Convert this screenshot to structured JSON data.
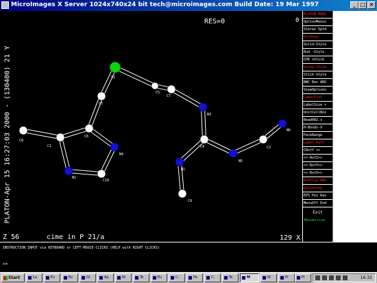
{
  "window": {
    "title": "MicroImages X Server  1024x740x24 bit  tech@microimages.com  Build Date: 19 Mar 1997"
  },
  "canvas": {
    "res_label": "RES=0",
    "corner_zero": "0",
    "side_stamp": "PLATON-Apr 15 16:27:03 2000 - (130400)  21 Y",
    "z_label": "Z 56",
    "cell_label": "cime in P 21/a",
    "scale_label": "129 X",
    "atom_colors": {
      "carbon": "#ffffff",
      "nitrogen": "#1010e0",
      "sulfur": "#10d010",
      "bond": "#ffffff"
    },
    "atoms": [
      {
        "id": "S1",
        "label": "S1",
        "type": "sulfur"
      },
      {
        "id": "C5a",
        "label": "C5",
        "type": "carbon"
      },
      {
        "id": "C5b",
        "label": "C5",
        "type": "carbon"
      },
      {
        "id": "C7",
        "label": "C7",
        "type": "carbon"
      },
      {
        "id": "N3",
        "label": "N3",
        "type": "nitrogen"
      },
      {
        "id": "C4",
        "label": "C4",
        "type": "carbon"
      },
      {
        "id": "N5",
        "label": "N5",
        "type": "nitrogen"
      },
      {
        "id": "C2",
        "label": "C2",
        "type": "carbon"
      },
      {
        "id": "N6",
        "label": "N6",
        "type": "nitrogen"
      },
      {
        "id": "N1",
        "label": "N1",
        "type": "nitrogen"
      },
      {
        "id": "C9",
        "label": "C9",
        "type": "carbon"
      },
      {
        "id": "C6",
        "label": "C6",
        "type": "carbon"
      },
      {
        "id": "C1",
        "label": "C1",
        "type": "carbon"
      },
      {
        "id": "C8",
        "label": "C8",
        "type": "carbon"
      },
      {
        "id": "N2",
        "label": "N2",
        "type": "nitrogen"
      },
      {
        "id": "C10",
        "label": "C10",
        "type": "carbon"
      },
      {
        "id": "N4",
        "label": "N4",
        "type": "nitrogen"
      }
    ],
    "bonds": [
      [
        "S1",
        "C5b"
      ],
      [
        "C5b",
        "C7"
      ],
      [
        "C7",
        "N3"
      ],
      [
        "N3",
        "C4"
      ],
      [
        "C4",
        "N1"
      ],
      [
        "N1",
        "C9"
      ],
      [
        "C4",
        "N5"
      ],
      [
        "N5",
        "C2"
      ],
      [
        "C2",
        "N6"
      ],
      [
        "S1",
        "C5a"
      ],
      [
        "C5a",
        "C6"
      ],
      [
        "C6",
        "C1"
      ],
      [
        "C1",
        "C8"
      ],
      [
        "C1",
        "N2"
      ],
      [
        "N2",
        "C10"
      ],
      [
        "C10",
        "N4"
      ],
      [
        "N4",
        "C6"
      ]
    ]
  },
  "menu": {
    "header": "PLATON MENU",
    "items": [
      {
        "label": "OptionMenus",
        "active": false
      },
      {
        "label": "Stereo Optd",
        "active": false
      },
      {
        "label": "OrtShow",
        "active": true
      },
      {
        "label": "Solid-Style",
        "active": false
      },
      {
        "label": "Rod  -Style",
        "active": false
      },
      {
        "label": "CPK  +Stick",
        "active": false
      },
      {
        "label": "Ortep-Style",
        "active": true
      },
      {
        "label": "Stick-Style",
        "active": false
      },
      {
        "label": "BWC Res ARU",
        "active": false
      },
      {
        "label": "ViewOptions",
        "active": false
      },
      {
        "label": "LabelPlot",
        "active": true
      },
      {
        "label": "LabelSize >",
        "active": false
      },
      {
        "label": "UnitCellBox",
        "active": false
      },
      {
        "label": "Read002.x",
        "active": false
      },
      {
        "label": "H-Bonds-X",
        "active": false
      },
      {
        "label": "PackRange",
        "active": false
      },
      {
        "label": "Label  Raff",
        "active": true
      },
      {
        "label": "CRotY >>",
        "active": false
      },
      {
        "label": "<<-RotZ>>",
        "active": false
      },
      {
        "label": "<<-RotY>>",
        "active": false
      },
      {
        "label": "<<-RotX>>",
        "active": false
      },
      {
        "label": "RotFlip ARU",
        "active": true
      },
      {
        "label": "Quickstep",
        "active": true
      },
      {
        "label": "EPS Pov Ras",
        "active": false
      },
      {
        "label": "MenuOff End",
        "active": false
      }
    ],
    "exit": "Exit",
    "footer": "MenuActive"
  },
  "instruction": {
    "text": "INSTRUCTION INPUT via KEYBOARD or LEFT-MOUSE-CLICKS (HELP with RIGHT CLICKS)",
    "prompt": ">>"
  },
  "taskbar": {
    "start": "Start",
    "tasks": [
      {
        "label": "La",
        "active": false
      },
      {
        "label": "Ex",
        "active": false
      },
      {
        "label": "Ex",
        "active": false
      },
      {
        "label": "Gl",
        "active": false
      },
      {
        "label": "Ap",
        "active": false
      },
      {
        "label": "Ni",
        "active": false
      },
      {
        "label": "Te",
        "active": false
      },
      {
        "label": "Eu",
        "active": false
      },
      {
        "label": "C:",
        "active": false
      },
      {
        "label": "Pa",
        "active": false
      },
      {
        "label": "C:",
        "active": false
      },
      {
        "label": "Te",
        "active": false
      },
      {
        "label": "M",
        "active": true
      },
      {
        "label": "W",
        "active": false
      },
      {
        "label": "Pr",
        "active": false
      },
      {
        "label": "Pr",
        "active": false
      }
    ],
    "clock": "16:32"
  }
}
